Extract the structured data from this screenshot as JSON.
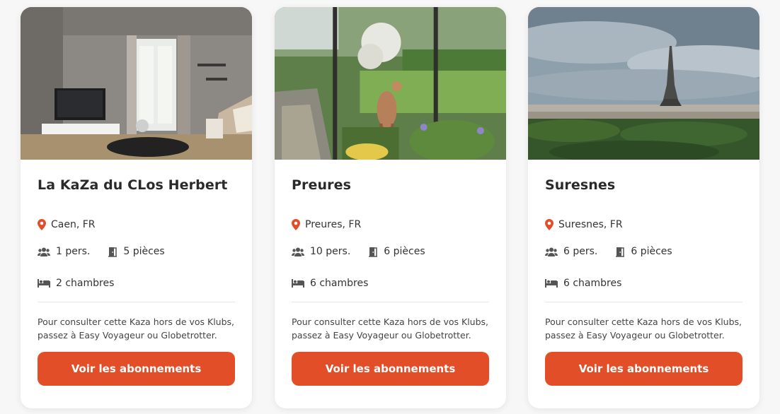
{
  "colors": {
    "accent": "#e24e28",
    "card_bg": "#ffffff",
    "text": "#2b2b2b"
  },
  "listings": [
    {
      "title": "La KaZa du CLos Herbert",
      "location": "Caen, FR",
      "persons": "1 pers.",
      "rooms": "5 pièces",
      "bedrooms": "2 chambres",
      "note": "Pour consulter cette Kaza hors de vos Klubs, passez à Easy Voyageur ou Globetrotter.",
      "cta_label": "Voir les abonnements"
    },
    {
      "title": "Preures",
      "location": "Preures, FR",
      "persons": "10 pers.",
      "rooms": "6 pièces",
      "bedrooms": "6 chambres",
      "note": "Pour consulter cette Kaza hors de vos Klubs, passez à Easy Voyageur ou Globetrotter.",
      "cta_label": "Voir les abonnements"
    },
    {
      "title": "Suresnes",
      "location": "Suresnes, FR",
      "persons": "6 pers.",
      "rooms": "6 pièces",
      "bedrooms": "6 chambres",
      "note": "Pour consulter cette Kaza hors de vos Klubs, passez à Easy Voyageur ou Globetrotter.",
      "cta_label": "Voir les abonnements"
    }
  ],
  "icons": {
    "location": "map-pin-icon",
    "persons": "users-icon",
    "rooms": "door-icon",
    "bedrooms": "bed-icon"
  }
}
